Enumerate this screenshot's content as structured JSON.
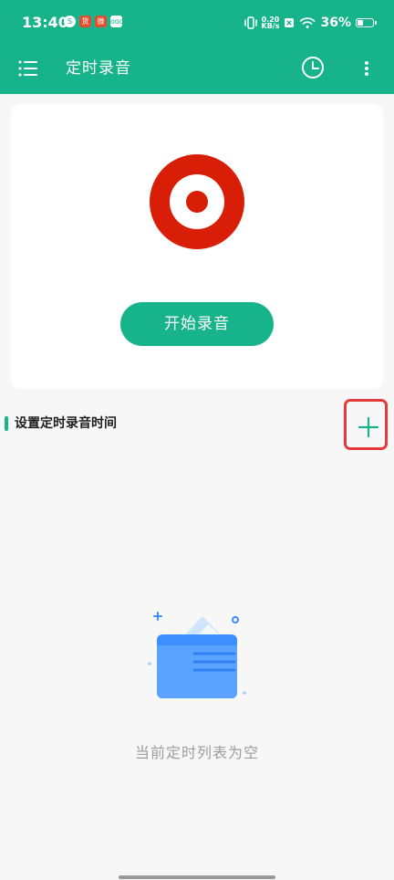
{
  "status_bar": {
    "time": "13:40",
    "network_speed_value": "0.20",
    "network_speed_unit": "KB/s",
    "battery_percent": "36%",
    "app_icons": [
      {
        "name": "green-app-icon",
        "text": "S"
      },
      {
        "name": "red-app-icon",
        "text": "货"
      },
      {
        "name": "red-app-icon-2",
        "text": "微"
      },
      {
        "name": "white-app-icon",
        "text": "ooo"
      }
    ]
  },
  "toolbar": {
    "title": "定时录音",
    "icons": {
      "menu": "list-menu-icon",
      "clock": "clock-icon",
      "more": "more-vertical-icon"
    }
  },
  "record_card": {
    "start_button_label": "开始录音",
    "record_icon": "record-target-icon"
  },
  "schedule_section": {
    "title": "设置定时录音时间",
    "add_icon": "plus-icon"
  },
  "empty_state": {
    "message": "当前定时列表为空",
    "illustration_icon": "empty-folder-icon"
  },
  "colors": {
    "accent": "#17b38b",
    "record_red": "#d81e06",
    "empty_text": "#9d9d9d",
    "highlight_border": "#e33a3a",
    "background": "#f7f7f7"
  }
}
